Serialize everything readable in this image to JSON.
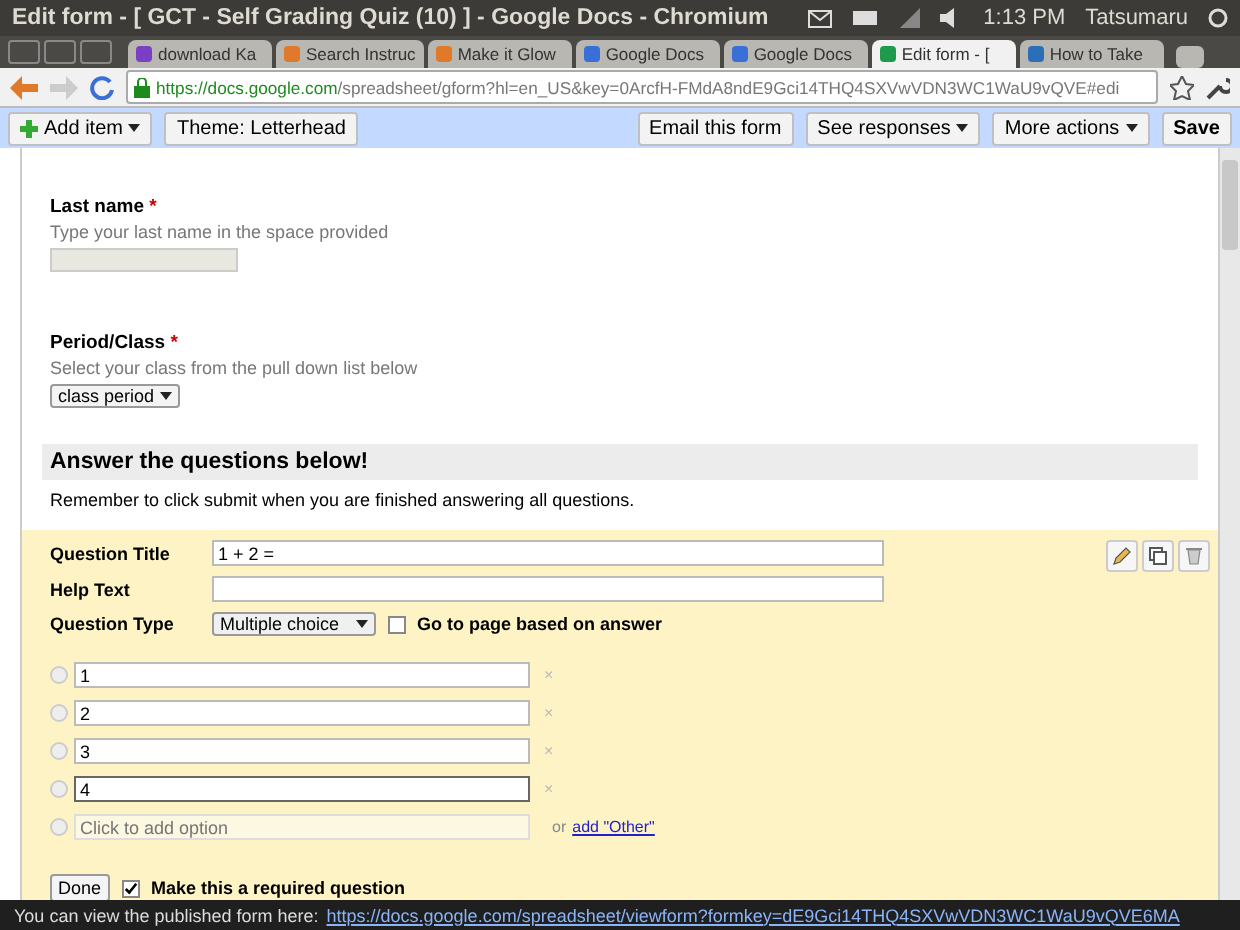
{
  "window": {
    "title": "Edit form - [ GCT - Self Grading Quiz (10) ] - Google Docs - Chromium"
  },
  "system_tray": {
    "time": "1:13 PM",
    "user": "Tatsumaru"
  },
  "tabs": [
    {
      "label": "download Ka",
      "selected": false,
      "color": "#7b3fc4"
    },
    {
      "label": "Search Instruc",
      "selected": false,
      "color": "#e07a2a"
    },
    {
      "label": "Make it Glow",
      "selected": false,
      "color": "#e07a2a"
    },
    {
      "label": "Google Docs",
      "selected": false,
      "color": "#3a6fd8"
    },
    {
      "label": "Google Docs",
      "selected": false,
      "color": "#3a6fd8"
    },
    {
      "label": "Edit form - [",
      "selected": true,
      "color": "#1e9b4a"
    },
    {
      "label": "How to Take",
      "selected": false,
      "color": "#2a6fb8"
    }
  ],
  "address_bar": {
    "host": "https://docs.google.com",
    "path": "/spreadsheet/gform?hl=en_US&key=0ArcfH-FMdA8ndE9Gci14THQ4SXVwVDN3WC1WaU9vQVE#edi"
  },
  "toolbar": {
    "left": [
      {
        "label": "Add item",
        "menu": true
      },
      {
        "label": "Theme:  Letterhead",
        "menu": false
      }
    ],
    "right": [
      {
        "label": "Email this form",
        "menu": false
      },
      {
        "label": "See responses",
        "menu": true
      },
      {
        "label": "More actions",
        "menu": true
      },
      {
        "label": "Save",
        "menu": false
      }
    ]
  },
  "form": {
    "last_name": {
      "label": "Last name",
      "required_mark": "*",
      "help": "Type your last name in the space provided"
    },
    "period": {
      "label": "Period/Class",
      "required_mark": "*",
      "help": "Select your class from the pull down list below",
      "select": "class period"
    },
    "section": {
      "title": "Answer the questions below!",
      "description": "Remember to click submit when you are finished answering all questions."
    },
    "question": {
      "title_label": "Question Title",
      "title_value": "1 + 2 =",
      "help_label": "Help Text",
      "type_label": "Question Type",
      "type_value": "Multiple choice",
      "go_to_page": {
        "label": "Go to page based on answer",
        "checked": false
      },
      "options": [
        {
          "value": "1",
          "remove": "×",
          "focused": false,
          "selected": false
        },
        {
          "value": "2",
          "remove": "×",
          "focused": false,
          "selected": false
        },
        {
          "value": "3",
          "remove": "×",
          "focused": false,
          "selected": false
        },
        {
          "value": "4",
          "remove": "×",
          "focused": true,
          "selected": false
        }
      ],
      "add_option": {
        "placeholder": "Click to add option",
        "selected": false
      },
      "or_text": "or",
      "add_other": "add \"Other\"",
      "done": "Done",
      "required": {
        "label": "Make this a required question",
        "checked": true
      }
    }
  },
  "status_bar": {
    "text": "You can view the published form here:",
    "link": "https://docs.google.com/spreadsheet/viewform?formkey=dE9Gci14THQ4SXVwVDN3WC1WaU9vQVE6MA"
  }
}
